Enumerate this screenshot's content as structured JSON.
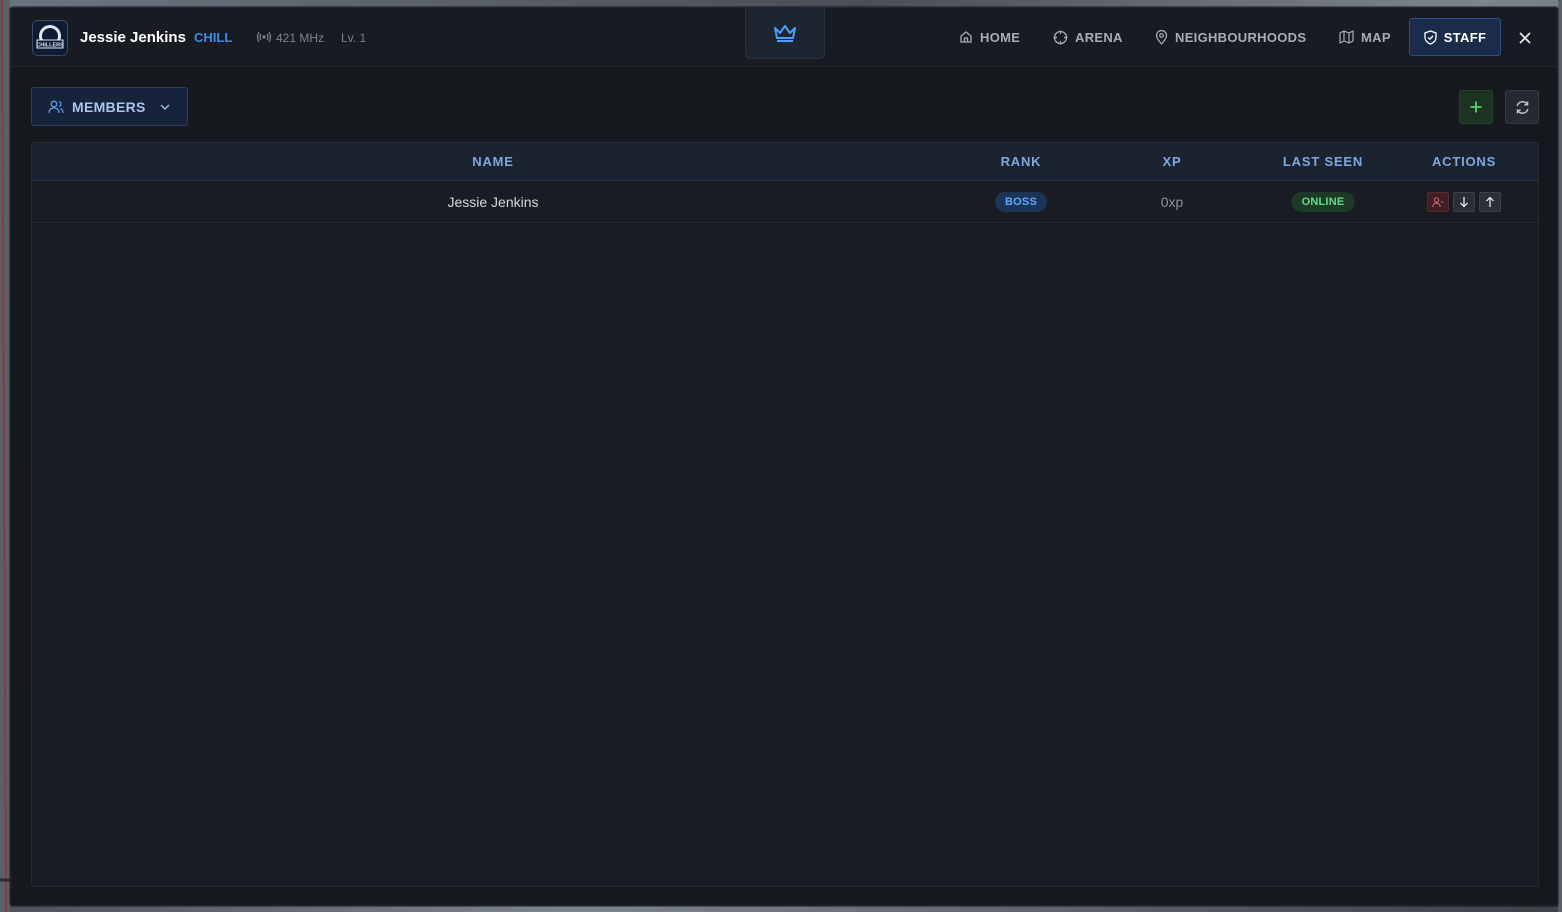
{
  "header": {
    "user_name": "Jessie Jenkins",
    "user_tag": "CHILL",
    "radio": "421 MHz",
    "level": "Lv. 1",
    "logo_text": "CHILLERS",
    "nav": [
      {
        "label": "HOME",
        "icon": "home-icon"
      },
      {
        "label": "ARENA",
        "icon": "crosshair-icon"
      },
      {
        "label": "NEIGHBOURHOODS",
        "icon": "map-pin-icon"
      },
      {
        "label": "MAP",
        "icon": "map-icon"
      },
      {
        "label": "STAFF",
        "icon": "shield-icon",
        "active": true
      }
    ]
  },
  "toolbar": {
    "members_label": "MEMBERS"
  },
  "table": {
    "columns": [
      "NAME",
      "RANK",
      "XP",
      "LAST SEEN",
      "ACTIONS"
    ],
    "rows": [
      {
        "name": "Jessie Jenkins",
        "rank": "BOSS",
        "xp": "0xp",
        "last_seen": "ONLINE"
      }
    ]
  },
  "colors": {
    "accent": "#3e8ee6",
    "online": "#5fdc86",
    "kick": "#c0505f",
    "background": "#15181d"
  }
}
